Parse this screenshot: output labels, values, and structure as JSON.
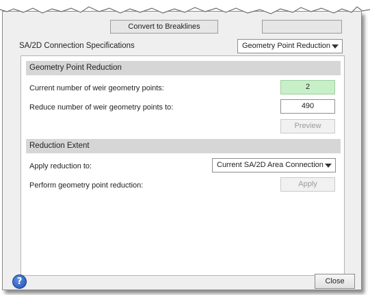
{
  "top_buttons": {
    "left_label": "Convert to Breaklines",
    "right_label": ""
  },
  "spec": {
    "title": "SA/2D Connection Specifications",
    "mode_selected": "Geometry Point Reduction"
  },
  "geometry_section": {
    "header": "Geometry Point Reduction",
    "current_label": "Current number of weir geometry points:",
    "current_value": "2",
    "reduce_label": "Reduce number of weir geometry points to:",
    "reduce_value": "490",
    "preview_label": "Preview"
  },
  "extent_section": {
    "header": "Reduction Extent",
    "apply_to_label": "Apply reduction to:",
    "apply_to_selected": "Current SA/2D Area Connection",
    "perform_label": "Perform geometry point reduction:",
    "apply_label": "Apply"
  },
  "footer": {
    "help_glyph": "?",
    "close_label": "Close"
  },
  "icons": {
    "help": "help-icon",
    "dropdown": "chevron-down-icon"
  },
  "colors": {
    "readonly_field": "#c8f0c8",
    "help_blue": "#1f4fb0",
    "section_header": "#d6d6d6"
  }
}
